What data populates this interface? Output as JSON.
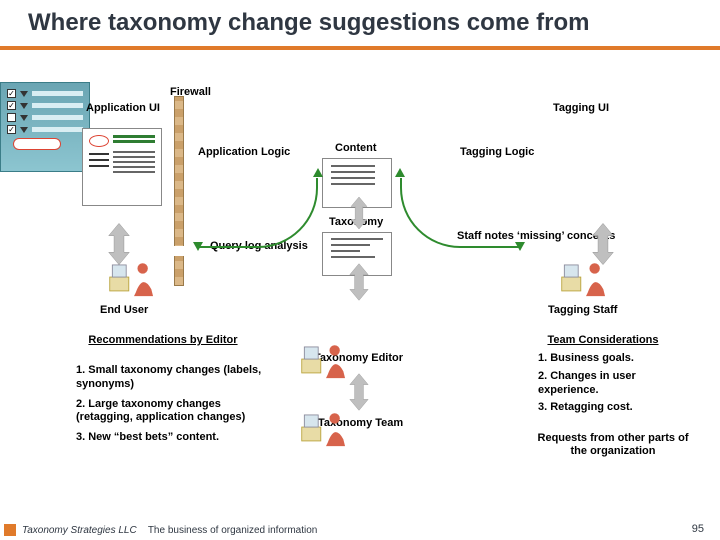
{
  "title": "Where taxonomy change suggestions come from",
  "labels": {
    "firewall": "Firewall",
    "app_ui": "Application UI",
    "tag_ui": "Tagging UI",
    "app_logic": "Application Logic",
    "content": "Content",
    "tag_logic": "Tagging Logic",
    "taxonomy": "Taxonomy",
    "query_log": "Query log analysis",
    "staff_notes": "Staff notes ‘missing’ concepts",
    "end_user": "End User",
    "tagging_staff": "Tagging Staff",
    "taxonomy_editor": "Taxonomy Editor",
    "taxonomy_team": "Taxonomy Team"
  },
  "recommendations": {
    "title": "Recommendations by Editor",
    "items": [
      "1. Small taxonomy changes (labels, synonyms)",
      "2. Large taxonomy changes (retagging, application changes)",
      "3. New “best bets” content."
    ]
  },
  "team": {
    "title": "Team Considerations",
    "items": [
      "1. Business goals.",
      "2. Changes in user experience.",
      "3. Retagging cost."
    ],
    "requests": "Requests from other parts of the organization"
  },
  "footer": {
    "brand": "Taxonomy Strategies LLC",
    "tagline": "The business of organized information",
    "page": "95"
  }
}
